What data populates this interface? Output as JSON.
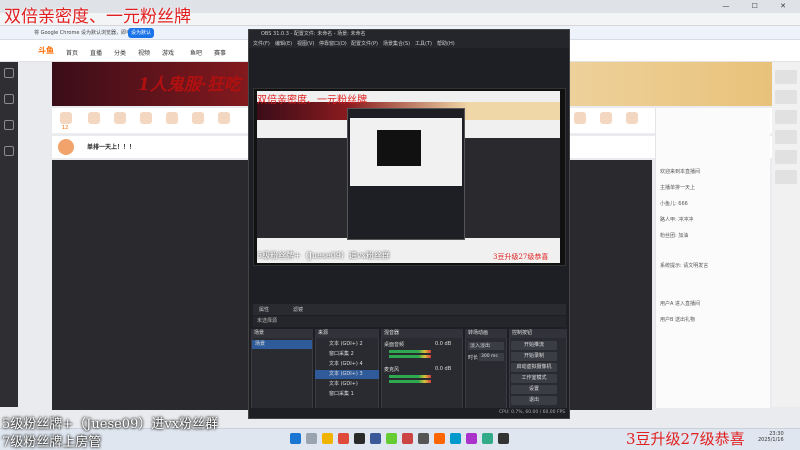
{
  "overlay": {
    "top_banner": "双倍亲密度、一元粉丝牌",
    "bottom_left_1": "5级粉丝牌+（Juese09）进vx粉丝群",
    "bottom_left_2": "7级粉丝牌上房管",
    "bottom_right": "3豆升级27级恭喜"
  },
  "browser": {
    "infobar_text": "将 Google Chrome 设为默认浏览器，即可确定...",
    "infobar_button": "设为默认",
    "window_controls": "— ☐ ✕"
  },
  "site": {
    "logo": "斗鱼",
    "nav": [
      "首页",
      "直播",
      "分类",
      "视频",
      "游戏",
      "鱼吧",
      "赛事"
    ],
    "banner_slogan": "1人鬼服·狂吃",
    "streamer_title": "单排一天上！！！",
    "room_level": "12"
  },
  "obs": {
    "title": "OBS 31.0.3 - 配置文件: 未命名 - 场景: 未命名",
    "menu": [
      "文件(F)",
      "编辑(E)",
      "视图(V)",
      "停靠窗口(D)",
      "配置文件(P)",
      "场景集合(S)",
      "工具(T)",
      "帮助(H)"
    ],
    "source_bar": [
      "属性",
      "滤镜"
    ],
    "no_source_label": "未选择源",
    "preview_overlay_top": "双倍亲密度、一元粉丝牌",
    "preview_overlay_bottom": "5级粉丝牌+（Juese09）进vx粉丝群",
    "preview_overlay_right": "3豆升级27级恭喜",
    "docks": {
      "scenes": {
        "title": "场景",
        "items": [
          "场景"
        ]
      },
      "sources": {
        "title": "来源",
        "items": [
          "文本 (GDI+) 2",
          "窗口采集 2",
          "文本 (GDI+) 4",
          "文本 (GDI+) 3",
          "文本 (GDI+)",
          "窗口采集 1"
        ]
      },
      "mixer": {
        "title": "混音器",
        "tracks": [
          {
            "name": "桌面音频",
            "db": "0.0 dB"
          },
          {
            "name": "麦克风",
            "db": "0.0 dB"
          }
        ]
      },
      "transitions": {
        "title": "转场动画",
        "type": "淡入淡出",
        "duration_label": "时长",
        "duration": "300 ms"
      },
      "controls": {
        "title": "控制按钮",
        "buttons": [
          "开始推流",
          "开始录制",
          "启动虚拟摄像机",
          "工作室模式",
          "设置",
          "退出"
        ]
      }
    },
    "status": "CPU: 0.7%, 60.00 / 60.00 FPS"
  },
  "chat": {
    "lines": [
      "欢迎来到本直播间",
      "主播单排一天上",
      "小鱼儿: 666",
      "路人甲: 冲冲冲",
      "粉丝团: 加油",
      "系统提示: 请文明发言",
      "用户A 进入直播间",
      "用户B 送出礼物"
    ]
  },
  "taskbar": {
    "time": "23:30",
    "date": "2025/1/16"
  }
}
